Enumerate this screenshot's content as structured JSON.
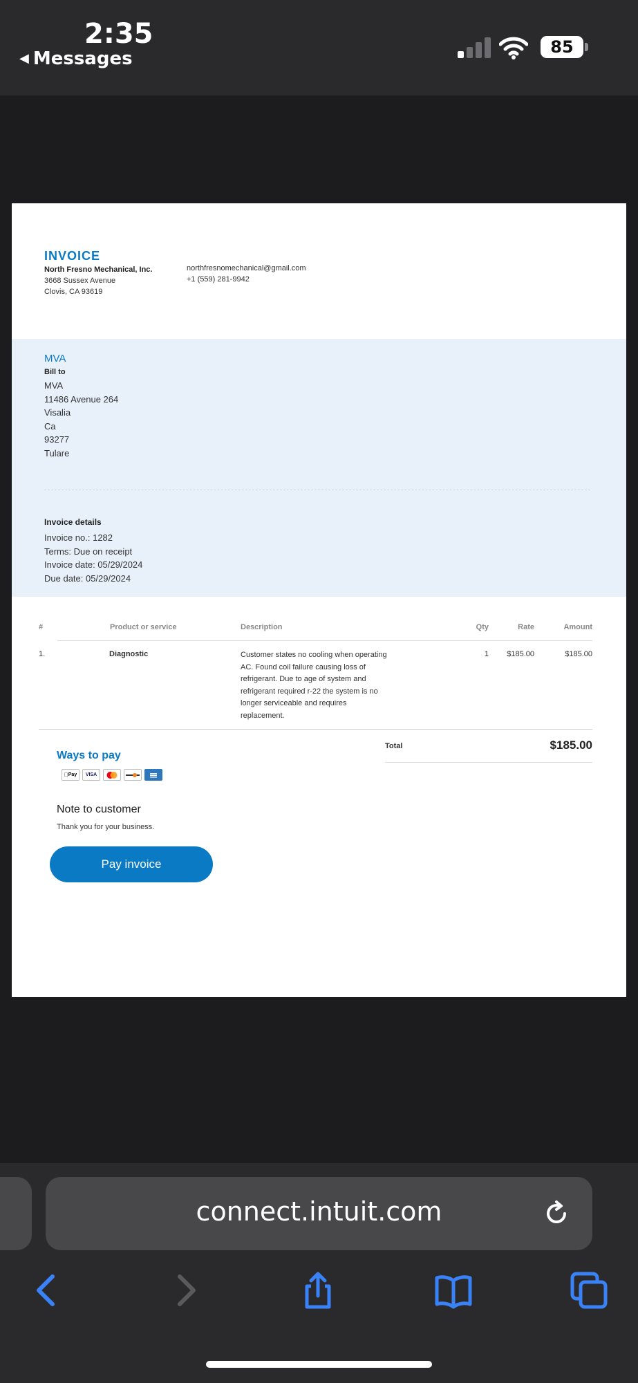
{
  "status_bar": {
    "time": "2:35",
    "back_label": "Messages",
    "battery": "85"
  },
  "invoice": {
    "title": "INVOICE",
    "company": "North Fresno Mechanical, Inc.",
    "address_lines": [
      "3668 Sussex Avenue",
      "Clovis, CA 93619"
    ],
    "email": "northfresnomechanical@gmail.com",
    "phone": "+1 (559) 281-9942",
    "customer_name": "MVA",
    "bill_to_label": "Bill to",
    "bill_to_lines": [
      "MVA",
      "11486 Avenue 264",
      "Visalia",
      "Ca",
      "93277",
      "Tulare"
    ],
    "details_title": "Invoice details",
    "details_lines": [
      "Invoice no.: 1282",
      "Terms: Due on receipt",
      "Invoice date: 05/29/2024",
      "Due date: 05/29/2024"
    ],
    "table": {
      "headers": [
        "#",
        "Product or service",
        "Description",
        "Qty",
        "Rate",
        "Amount"
      ],
      "rows": [
        {
          "num": "1.",
          "product": "Diagnostic",
          "description": "Customer states no cooling when operating AC. Found coil failure causing loss of refrigerant. Due to age of system and refrigerant required r-22 the system is no longer serviceable and requires replacement.",
          "qty": "1",
          "rate": "$185.00",
          "amount": "$185.00"
        }
      ]
    },
    "total_label": "Total",
    "total_value": "$185.00",
    "ways_to_pay": "Ways to pay",
    "payment_icons": [
      "apple-pay-icon",
      "visa-icon",
      "mastercard-icon",
      "discover-icon",
      "amex-icon"
    ],
    "payment_labels": {
      "apple_pay": "Pay",
      "visa": "VISA"
    },
    "note_title": "Note to customer",
    "note_body": "Thank you for your business.",
    "pay_button": "Pay invoice"
  },
  "browser": {
    "url": "connect.intuit.com"
  },
  "colors": {
    "accent": "#0a7ac4",
    "bill_background": "#e8f1fa",
    "ios_blue": "#3a82f7"
  }
}
